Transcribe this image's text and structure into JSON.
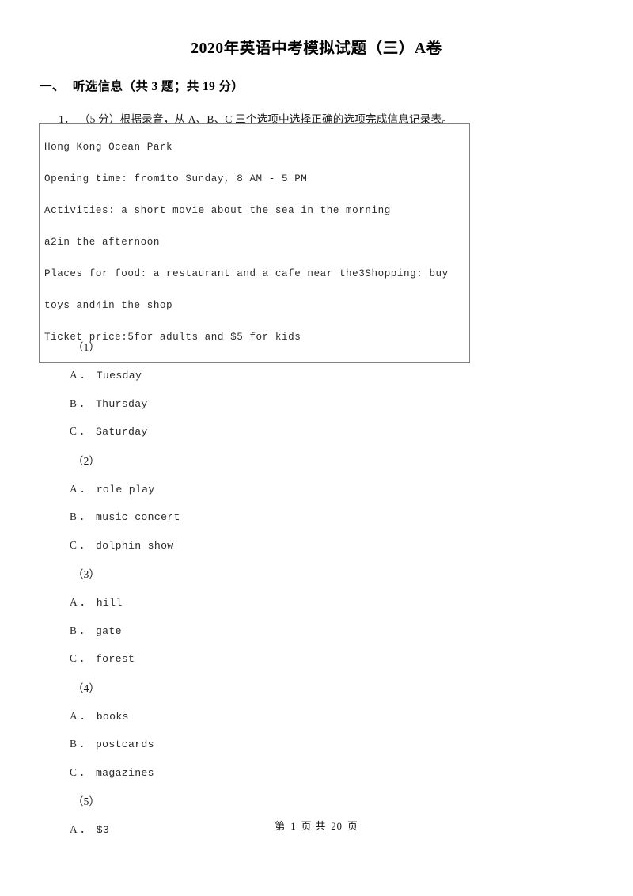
{
  "document": {
    "title": "2020年英语中考模拟试题（三）A卷"
  },
  "section": {
    "number": "一、",
    "title": "听选信息（共 3 题；共 19 分）"
  },
  "question": {
    "number": "1．",
    "stem": "（5 分）根据录音，从 A、B、C 三个选项中选择正确的选项完成信息记录表。"
  },
  "passage": {
    "lines": [
      "Hong Kong Ocean Park",
      "Opening time: from1to Sunday, 8 AM - 5 PM",
      "Activities: a short movie about the sea in the morning",
      "a2in the afternoon",
      "Places for food: a restaurant and a cafe near the3Shopping: buy toys and4in the shop",
      "Ticket price:5for adults and $5 for kids"
    ]
  },
  "groups": [
    {
      "label": "（1）",
      "options": [
        {
          "letter": "A",
          "dot": "．",
          "text": "Tuesday"
        },
        {
          "letter": "B",
          "dot": "．",
          "text": "Thursday"
        },
        {
          "letter": "C",
          "dot": "．",
          "text": "Saturday"
        }
      ]
    },
    {
      "label": "（2）",
      "options": [
        {
          "letter": "A",
          "dot": "．",
          "text": "role play"
        },
        {
          "letter": "B",
          "dot": "．",
          "text": "music concert"
        },
        {
          "letter": "C",
          "dot": "．",
          "text": "dolphin show"
        }
      ]
    },
    {
      "label": "（3）",
      "options": [
        {
          "letter": "A",
          "dot": "．",
          "text": "hill"
        },
        {
          "letter": "B",
          "dot": "．",
          "text": "gate"
        },
        {
          "letter": "C",
          "dot": "．",
          "text": "forest"
        }
      ]
    },
    {
      "label": "（4）",
      "options": [
        {
          "letter": "A",
          "dot": "．",
          "text": "books"
        },
        {
          "letter": "B",
          "dot": "．",
          "text": "postcards"
        },
        {
          "letter": "C",
          "dot": "．",
          "text": "magazines"
        }
      ]
    },
    {
      "label": "（5）",
      "options": [
        {
          "letter": "A",
          "dot": "．",
          "text": "$3"
        }
      ]
    }
  ],
  "footer": {
    "prefix": "第",
    "current_page": "1",
    "middle": "页 共",
    "total_pages": "20",
    "suffix": "页"
  }
}
